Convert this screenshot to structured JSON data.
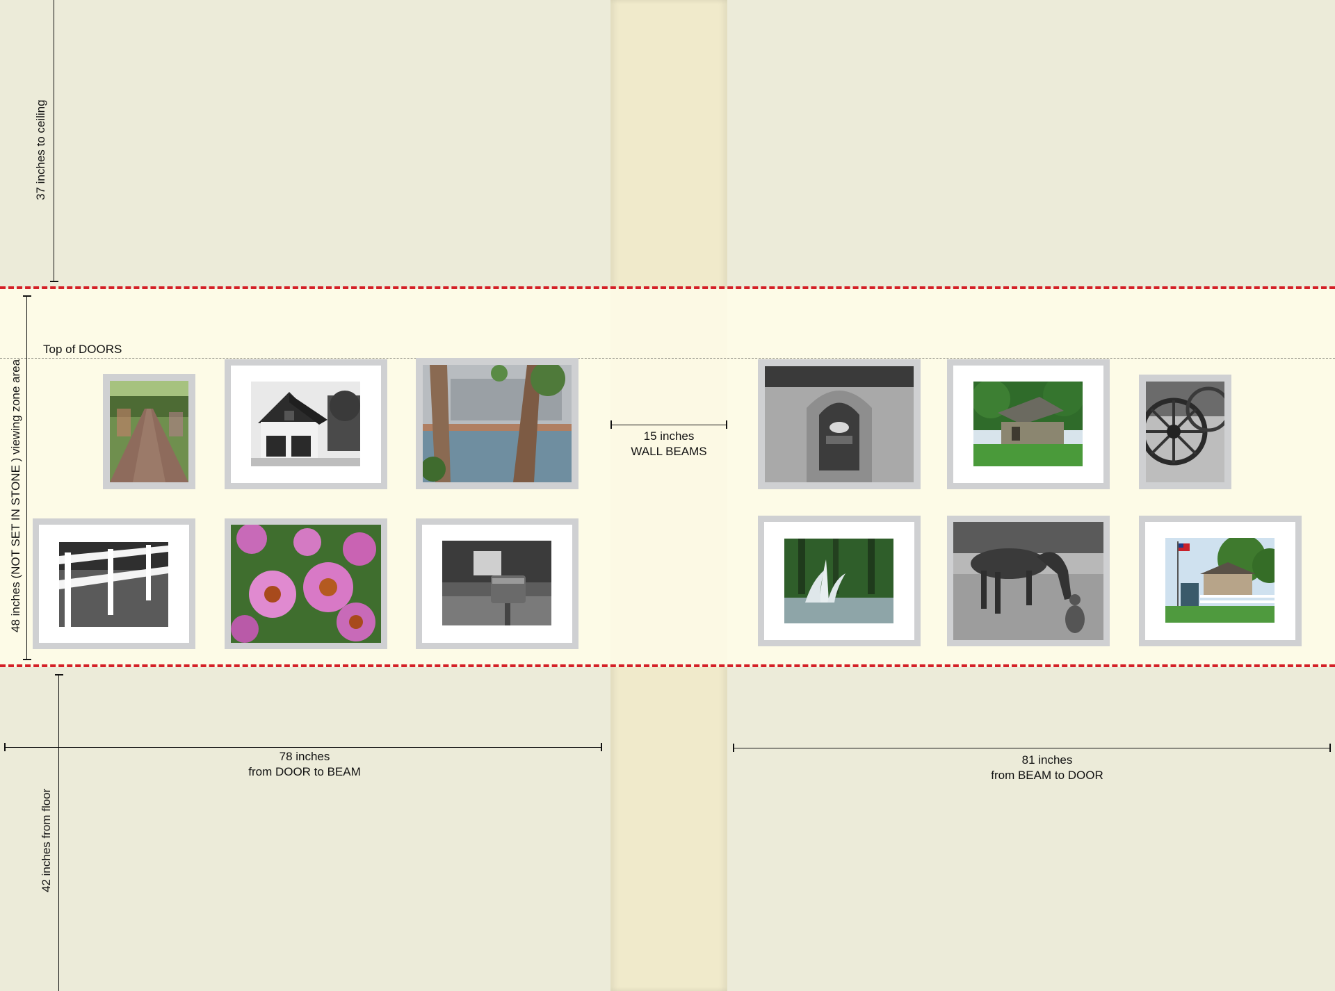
{
  "labels": {
    "ceiling": "37 inches to ceiling",
    "viewing_zone": "48 inches (NOT SET IN STONE ) viewing zone area",
    "top_of_doors": "Top of DOORS",
    "beam_width_line1": "15 inches",
    "beam_width_line2": "WALL BEAMS",
    "left_span_line1": "78 inches",
    "left_span_line2": "from DOOR to BEAM",
    "right_span_line1": "81 inches",
    "right_span_line2": "from BEAM to DOOR",
    "floor": "42 inches from floor"
  },
  "colors": {
    "wall": "#ecebd9",
    "viewing_zone": "#fdfbe7",
    "beam": "#f0eacb",
    "zone_border": "#d42027",
    "frame": "#cfd0d2",
    "mat": "#ffffff"
  },
  "photos": [
    {
      "subject": "brick garden path",
      "tone": "color"
    },
    {
      "subject": "white barn house",
      "tone": "black-and-white"
    },
    {
      "subject": "birch trees by town center pond",
      "tone": "color"
    },
    {
      "subject": "white fence",
      "tone": "black-and-white"
    },
    {
      "subject": "pink coneflowers",
      "tone": "color"
    },
    {
      "subject": "park mailbox",
      "tone": "black-and-white"
    },
    {
      "subject": "Drake Park stone sign",
      "tone": "black-and-white"
    },
    {
      "subject": "log cabin",
      "tone": "color"
    },
    {
      "subject": "wagon wheel",
      "tone": "black-and-white"
    },
    {
      "subject": "pond fountain",
      "tone": "color"
    },
    {
      "subject": "horse sculpture with dog",
      "tone": "black-and-white"
    },
    {
      "subject": "house with flag and fence",
      "tone": "color"
    }
  ]
}
